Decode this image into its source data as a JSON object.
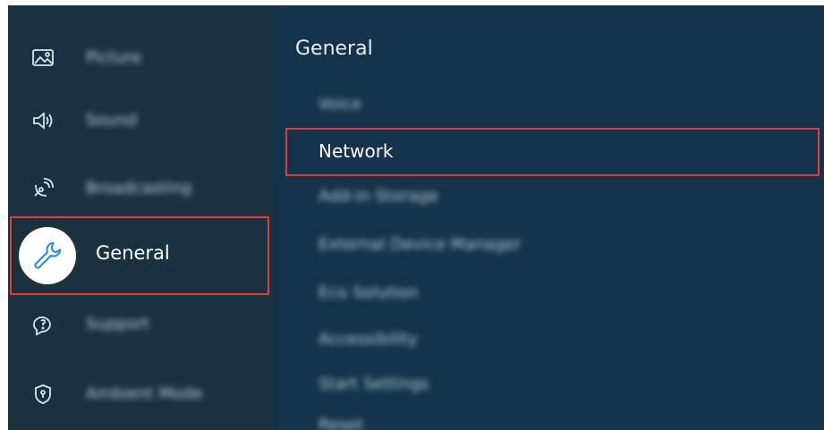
{
  "sidebar": {
    "items": [
      {
        "label": "Picture",
        "icon": "picture-icon"
      },
      {
        "label": "Sound",
        "icon": "sound-icon"
      },
      {
        "label": "Broadcasting",
        "icon": "broadcasting-icon"
      },
      {
        "label": "General",
        "icon": "wrench-icon",
        "selected": true
      },
      {
        "label": "Support",
        "icon": "support-icon"
      },
      {
        "label": "Ambient Mode",
        "icon": "shield-icon"
      }
    ]
  },
  "main": {
    "title": "General",
    "items": [
      {
        "label": "Voice"
      },
      {
        "label": "Network",
        "selected": true
      },
      {
        "label": "Add-in Storage"
      },
      {
        "label": "External Device Manager"
      },
      {
        "label": "Eco Solution"
      },
      {
        "label": "Accessibility"
      },
      {
        "label": "Start Settings"
      },
      {
        "label": "Reset"
      }
    ]
  },
  "colors": {
    "highlight_border": "#e0393e",
    "background": "#15334a",
    "sidebar_background": "#1b3340",
    "text": "#ffffff"
  }
}
